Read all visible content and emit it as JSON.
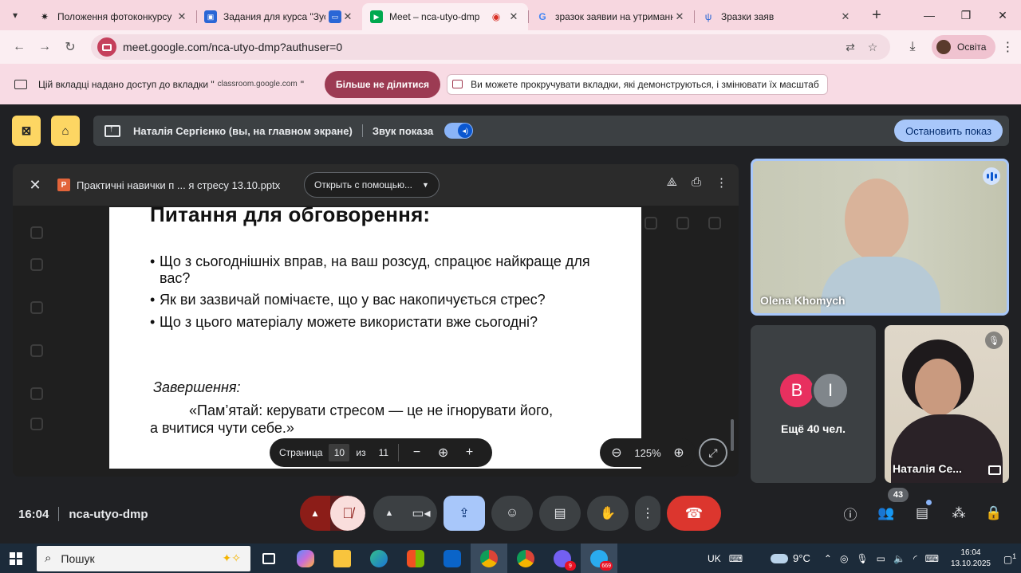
{
  "browser": {
    "tabs": [
      {
        "title": "Положення фотоконкурсу",
        "favicon": "openai-icon"
      },
      {
        "title": "Задания для курса \"Зуст",
        "favicon": "classroom-icon"
      },
      {
        "title": "Meet – nca-utyo-dmp",
        "favicon": "meet-icon",
        "active": true
      },
      {
        "title": "зразок заявии на утримання",
        "favicon": "google-icon"
      },
      {
        "title": "Зразки заяв",
        "favicon": "trident-icon"
      }
    ],
    "url": "meet.google.com/nca-utyo-dmp?authuser=0",
    "profile_label": "Освіта",
    "accent_color": "#f7d7e0"
  },
  "infobar": {
    "message": "Цій вкладці надано доступ до вкладки \"",
    "domain": "classroom.google.com",
    "message_end": "\"",
    "stop_button": "Більше не ділитися",
    "tip": "Ви можете прокручувати вкладки, які демонструються, і змінювати їх масштаб"
  },
  "meet": {
    "presenter_text": "Наталія Сергієнко (вы, на главном экране)",
    "sound_label": "Звук показа",
    "sound_on": true,
    "stop_button": "Остановить показ",
    "viewer": {
      "filename": "Практичні навички п ... я стресу 13.10.pptx",
      "open_with": "Открыть с помощью...",
      "page_label": "Страница",
      "page_current": "10",
      "page_of": "из",
      "page_total": "11",
      "zoom": "125%"
    },
    "slide": {
      "title": "Питання для обговорення:",
      "bullets": [
        "Що з сьогоднішніх вправ, на ваш розсуд, спрацює найкраще для вас?",
        "Як ви зазвичай помічаєте, що у вас накопичується стрес?",
        "Що з цього матеріалу можете використати вже сьогодні?"
      ],
      "subtitle": "Завершення:",
      "quote": "«Пам’ятай: керувати стресом — це не ігнорувати його, а вчитися чути себе.»"
    },
    "participants": {
      "main_speaker": "Olena Khomych",
      "self_name": "Наталія Се...",
      "avatar_letters": [
        "В",
        "І"
      ],
      "avatar_colors": [
        "#e8305f",
        "#80868b"
      ],
      "more_label": "Ещё 40 чел.",
      "count": "43"
    },
    "bottom": {
      "time": "16:04",
      "meeting_code": "nca-utyo-dmp"
    }
  },
  "taskbar": {
    "search_placeholder": "Пошук",
    "language": "UK",
    "temperature": "9°C",
    "time": "16:04",
    "date": "13.10.2025",
    "viber_badge": "9",
    "telegram_badge": "669",
    "notif_count": "1"
  }
}
